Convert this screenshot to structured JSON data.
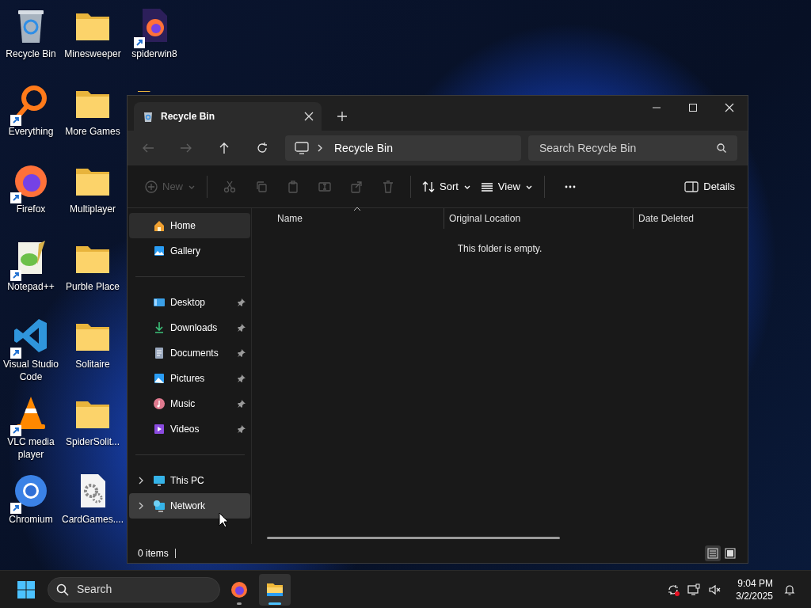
{
  "desktop": {
    "icons": [
      {
        "label": "Recycle Bin",
        "kind": "recycle-bin",
        "shortcut": false
      },
      {
        "label": "Everything",
        "kind": "everything",
        "shortcut": true
      },
      {
        "label": "Firefox",
        "kind": "firefox",
        "shortcut": true
      },
      {
        "label": "Notepad++",
        "kind": "notepad",
        "shortcut": true
      },
      {
        "label": "Visual Studio Code",
        "kind": "vscode",
        "shortcut": true
      },
      {
        "label": "VLC media player",
        "kind": "vlc",
        "shortcut": true
      },
      {
        "label": "Chromium",
        "kind": "chromium",
        "shortcut": true
      },
      {
        "label": "Minesweeper",
        "kind": "folder",
        "shortcut": false
      },
      {
        "label": "More Games",
        "kind": "folder",
        "shortcut": false
      },
      {
        "label": "Multiplayer",
        "kind": "folder",
        "shortcut": false
      },
      {
        "label": "Purble Place",
        "kind": "folder",
        "shortcut": false
      },
      {
        "label": "Solitaire",
        "kind": "folder",
        "shortcut": false
      },
      {
        "label": "SpiderSolit...",
        "kind": "folder",
        "shortcut": false
      },
      {
        "label": "CardGames....",
        "kind": "settings-file",
        "shortcut": false
      },
      {
        "label": "spiderwin8",
        "kind": "web-page",
        "shortcut": true
      },
      {
        "kind": "folder",
        "shortcut": false
      }
    ]
  },
  "explorer": {
    "tabs": [
      {
        "title": "Recycle Bin",
        "selected": true
      }
    ],
    "navigation": [
      {
        "kind": "back",
        "disabled": true
      },
      {
        "kind": "forward",
        "disabled": true
      },
      {
        "kind": "up",
        "disabled": false
      },
      {
        "kind": "refresh",
        "disabled": false
      }
    ],
    "address": {
      "path": [
        "Recycle Bin"
      ]
    },
    "search": {
      "placeholder": "Search Recycle Bin"
    },
    "toolbar": [
      {
        "kind": "new",
        "label": "New",
        "disabled": true
      },
      {
        "kind": "divider"
      },
      {
        "kind": "cut",
        "disabled": true
      },
      {
        "kind": "copy",
        "disabled": true
      },
      {
        "kind": "paste",
        "disabled": true
      },
      {
        "kind": "rename",
        "disabled": true
      },
      {
        "kind": "share",
        "disabled": true
      },
      {
        "kind": "delete",
        "disabled": true
      },
      {
        "kind": "divider"
      },
      {
        "kind": "sort",
        "label": "Sort",
        "disabled": false
      },
      {
        "kind": "view",
        "label": "View",
        "disabled": false
      },
      {
        "kind": "divider"
      },
      {
        "kind": "more",
        "disabled": false
      }
    ],
    "details_button": {
      "label": "Details"
    },
    "sidebar": {
      "groups": [
        {
          "items": [
            {
              "label": "Home",
              "kind": "home",
              "selected": true,
              "hovered": false,
              "pinned": false,
              "expandable": false
            },
            {
              "label": "Gallery",
              "kind": "gallery",
              "selected": false,
              "hovered": false,
              "pinned": false,
              "expandable": false
            }
          ]
        },
        {
          "items": [
            {
              "label": "Desktop",
              "kind": "desktop",
              "selected": false,
              "hovered": false,
              "pinned": true,
              "expandable": false
            },
            {
              "label": "Downloads",
              "kind": "downloads",
              "selected": false,
              "hovered": false,
              "pinned": true,
              "expandable": false
            },
            {
              "label": "Documents",
              "kind": "documents",
              "selected": false,
              "hovered": false,
              "pinned": true,
              "expandable": false
            },
            {
              "label": "Pictures",
              "kind": "pictures",
              "selected": false,
              "hovered": false,
              "pinned": true,
              "expandable": false
            },
            {
              "label": "Music",
              "kind": "music",
              "selected": false,
              "hovered": false,
              "pinned": true,
              "expandable": false
            },
            {
              "label": "Videos",
              "kind": "videos",
              "selected": false,
              "hovered": false,
              "pinned": true,
              "expandable": false
            }
          ]
        },
        {
          "items": [
            {
              "label": "This PC",
              "kind": "this-pc",
              "selected": false,
              "hovered": false,
              "pinned": false,
              "expandable": true
            },
            {
              "label": "Network",
              "kind": "network",
              "selected": false,
              "hovered": true,
              "pinned": false,
              "expandable": true
            }
          ]
        }
      ]
    },
    "columns": [
      {
        "label": "Name",
        "sorted": true
      },
      {
        "label": "Original Location",
        "sorted": false
      },
      {
        "label": "Date Deleted",
        "sorted": false
      }
    ],
    "empty_message": "This folder is empty.",
    "status_bar": {
      "item_count": "0 items",
      "views": [
        {
          "kind": "details",
          "selected": true
        },
        {
          "kind": "tiles",
          "selected": false
        }
      ]
    }
  },
  "taskbar": {
    "search": {
      "placeholder": "Search"
    },
    "apps": [
      {
        "kind": "firefox",
        "running": true,
        "active": false
      },
      {
        "kind": "explorer",
        "running": true,
        "active": true
      }
    ],
    "tray": [
      {
        "kind": "sync",
        "alert": true
      },
      {
        "kind": "network",
        "alert": false
      },
      {
        "kind": "volume-muted",
        "alert": false
      }
    ],
    "time": "9:04 PM",
    "date": "3/2/2025"
  }
}
